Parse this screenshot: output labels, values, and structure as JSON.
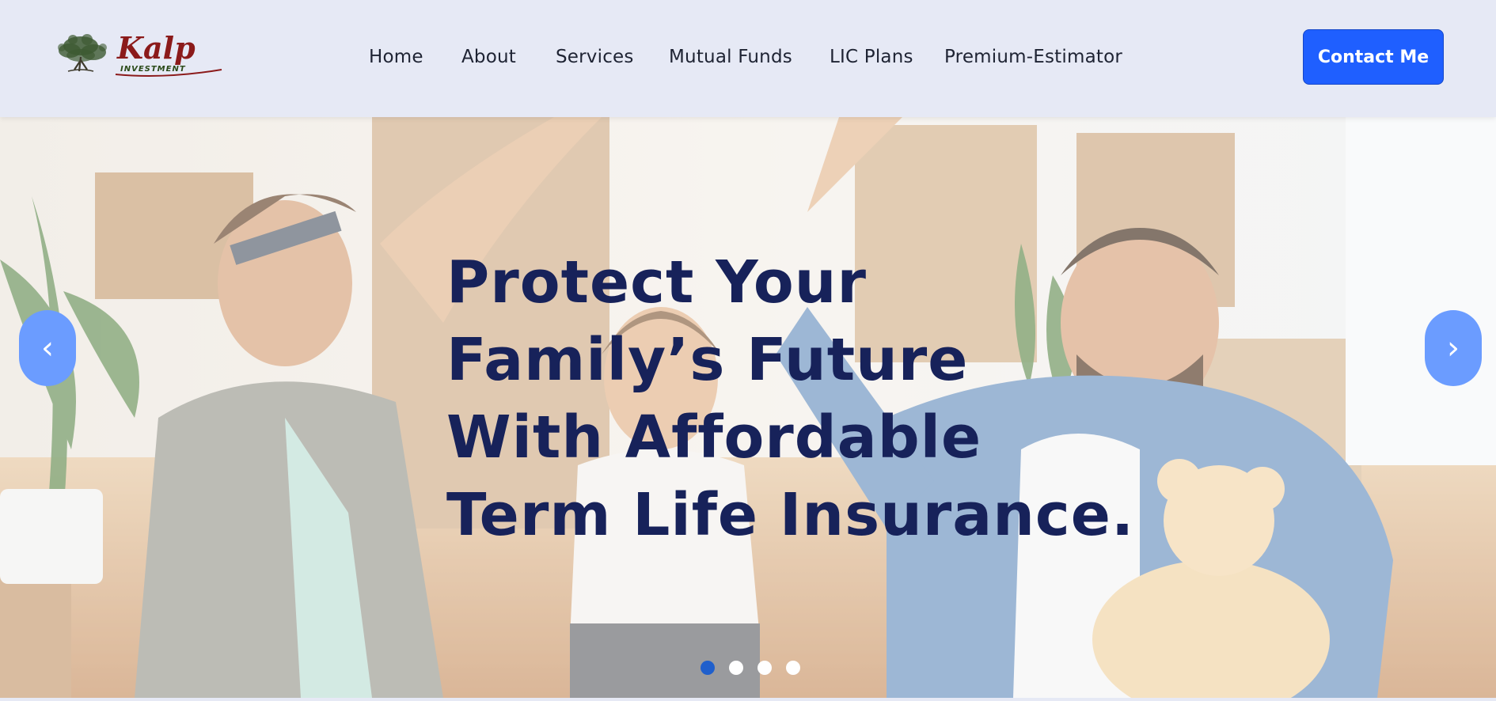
{
  "header": {
    "logo": {
      "text": "Kalp",
      "subtext": "INVESTMENT",
      "colors": {
        "script": "#8b1a1a",
        "subtext": "#2a4a18",
        "tree": "#3a5230"
      }
    },
    "nav": [
      {
        "label": "Home",
        "icon": null
      },
      {
        "label": "About",
        "icon": null
      },
      {
        "label": "Services",
        "icon": null
      },
      {
        "label": "Mutual Funds",
        "icon": null
      },
      {
        "label": "LIC Plans",
        "icon": null
      },
      {
        "label": "Premium-Estimator",
        "icon": null
      }
    ],
    "contact_label": "Contact Me"
  },
  "hero": {
    "title": "Protect Your Family’s Future With Affordable Term Life Insurance.",
    "prev_symbol": "‹",
    "next_symbol": "›",
    "slides_count": 4,
    "active_slide": 1
  },
  "colors": {
    "accent": "#1f5fff",
    "title": "#17225a",
    "arrow_bg": "#6b9cff",
    "dot_active": "#1f5fcc",
    "header_bg": "#e6e9f5"
  }
}
